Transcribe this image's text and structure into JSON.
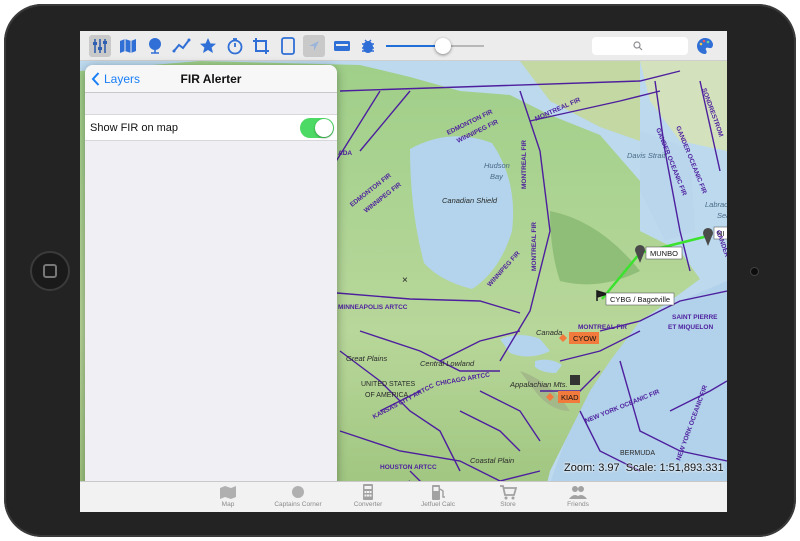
{
  "toolbar": {
    "icons": [
      "sliders-icon",
      "map-icon",
      "globe-icon",
      "route-icon",
      "star-icon",
      "timer-icon",
      "crop-icon",
      "tablet-icon",
      "location-arrow-icon",
      "card-icon",
      "bug-icon"
    ],
    "slider_value": 0.58,
    "search_placeholder": ""
  },
  "panel": {
    "back_label": "Layers",
    "title": "FIR Alerter",
    "setting_label": "Show FIR on map",
    "setting_on": true
  },
  "map": {
    "fir_labels": [
      "EDMONTON FIR",
      "WINNIPEG FIR",
      "MONTREAL FIR",
      "EDMONTON FIR",
      "WINNIPEG FIR",
      "WINNIPEG FIR",
      "MONTREAL FIR",
      "MONTREAL FIR",
      "GANDER OCEANIC FIR",
      "SONDRESTROM",
      "GANDER OCEANIC FIR",
      "GANDER",
      "MONTREAL FIR",
      "SAINT PIERRE",
      "ET MIQUELON",
      "NEW YORK OCEANIC FIR",
      "NEW YORK OCEANIC FIR",
      "MINNEAPOLIS ARTCC",
      "CHICAGO ARTCC",
      "KANSAS CITY ARTCC",
      "HOUSTON ARTCC",
      "ADA"
    ],
    "geo_labels": [
      "Hudson",
      "Bay",
      "Davis Strait",
      "Labrador",
      "Sea",
      "Canadian Shield",
      "Great Plains",
      "Central Lowland",
      "Appalachian Mts.",
      "UNITED STATES",
      "OF AMERICA",
      "Canada",
      "Coastal Plain",
      "BERMUDA"
    ],
    "waypoints": [
      "MUNBO",
      "CYBG / Bagotville",
      "NI"
    ],
    "airports": [
      "CYOW",
      "KIAD"
    ]
  },
  "status": {
    "zoom_label": "Zoom:",
    "zoom_value": "3.97",
    "scale_label": "Scale:",
    "scale_value": "1:51,893.331"
  },
  "tabbar": {
    "tabs": [
      {
        "label": "Map",
        "icon": "map-tab-icon"
      },
      {
        "label": "Captains Corner",
        "icon": "captains-corner-icon"
      },
      {
        "label": "Converter",
        "icon": "calculator-icon"
      },
      {
        "label": "Jetfuel Calc",
        "icon": "fuel-pump-icon"
      },
      {
        "label": "Store",
        "icon": "cart-icon"
      },
      {
        "label": "Friends",
        "icon": "friends-icon"
      }
    ]
  },
  "colors": {
    "fir_line": "#4d1f9e",
    "route": "#3be22e",
    "airport_box": "#f07b3c",
    "toggle_on": "#4cd964",
    "accent": "#1a7ff5"
  }
}
